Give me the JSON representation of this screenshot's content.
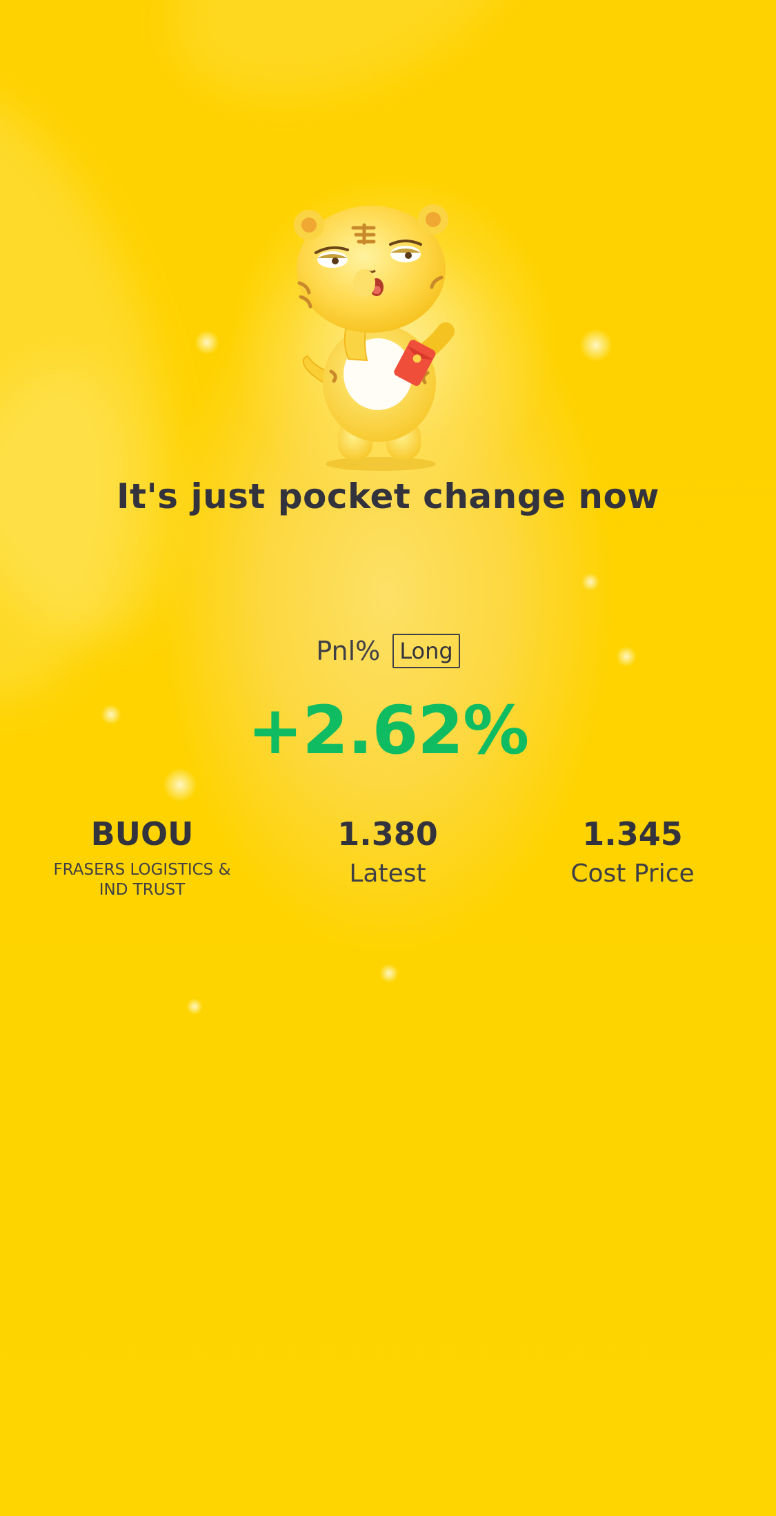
{
  "headline": "It's just pocket change now",
  "pnl": {
    "label": "Pnl%",
    "direction_badge": "Long",
    "value": "+2.62%",
    "value_color": "#0fbc62"
  },
  "stock": {
    "ticker": "BUOU",
    "name": "FRASERS LOGISTICS & IND TRUST"
  },
  "latest": {
    "value": "1.380",
    "label": "Latest"
  },
  "cost": {
    "value": "1.345",
    "label": "Cost Price"
  },
  "colors": {
    "background": "#fed200",
    "text": "#33333d",
    "positive": "#0fbc62"
  },
  "icons": {
    "mascot": "tiger-mascot-with-red-envelope"
  }
}
